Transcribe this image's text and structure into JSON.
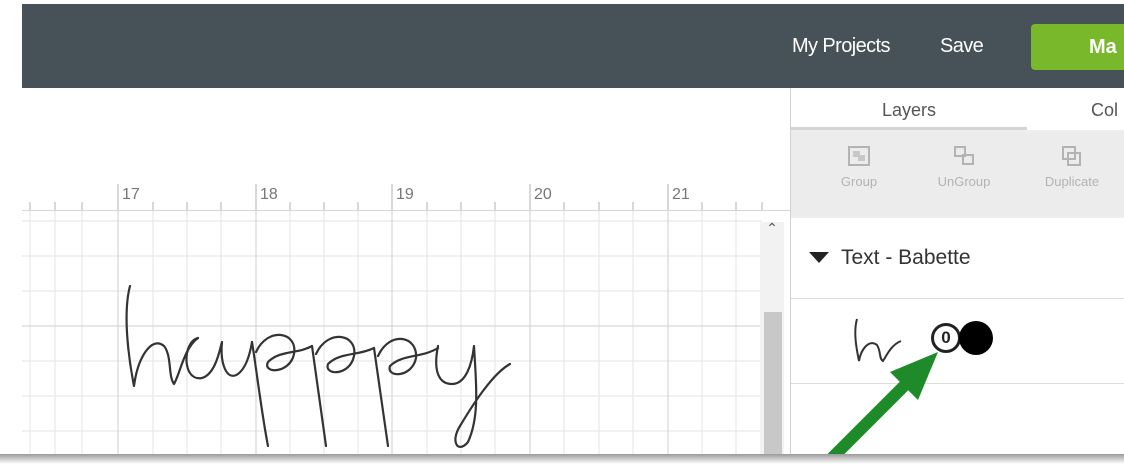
{
  "header": {
    "my_projects": "My Projects",
    "save": "Save",
    "make_label": "Ma"
  },
  "ruler": {
    "labels": [
      "17",
      "18",
      "19",
      "20",
      "21"
    ]
  },
  "canvas": {
    "text": "happy"
  },
  "panel": {
    "tabs": [
      {
        "label": "Layers",
        "active": true
      },
      {
        "label": "Col"
      }
    ],
    "tools": [
      {
        "label": "Group",
        "icon": "group-icon"
      },
      {
        "label": "UnGroup",
        "icon": "ungroup-icon"
      },
      {
        "label": "Duplicate",
        "icon": "duplicate-icon"
      }
    ],
    "layer_group": {
      "title": "Text - Babette"
    },
    "layer_row": {
      "thumb_text": "h",
      "indicator": "0"
    }
  },
  "colors": {
    "topbar": "#475158",
    "make_button": "#78b82a",
    "arrow": "#1f8a2a"
  }
}
